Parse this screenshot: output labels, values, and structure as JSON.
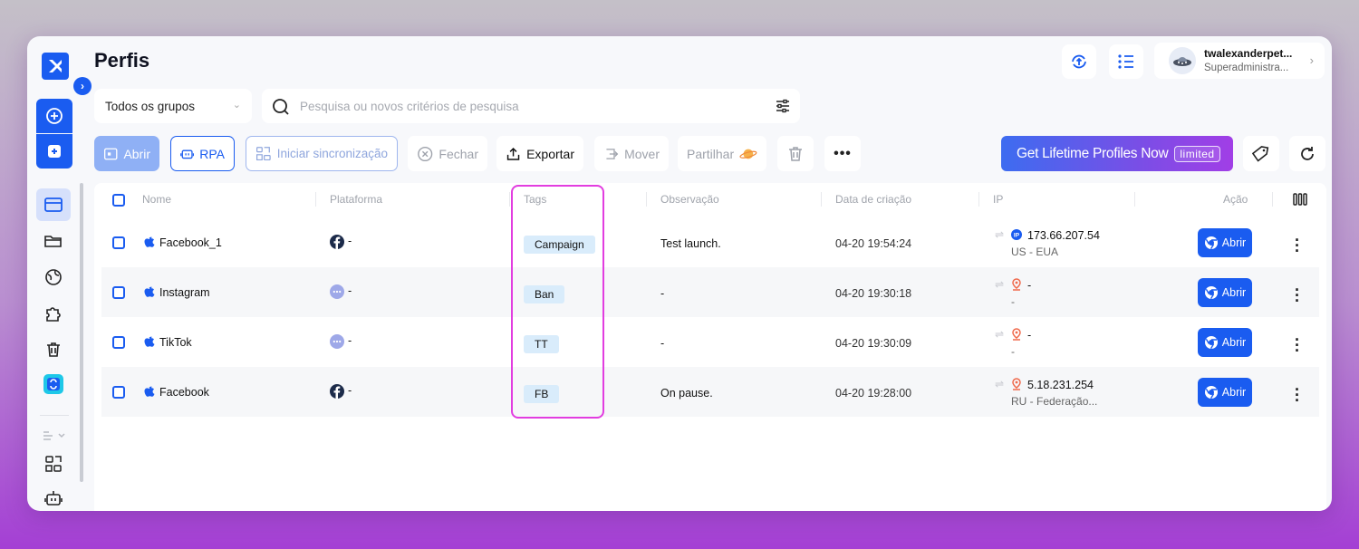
{
  "page": {
    "title": "Perfis"
  },
  "user": {
    "name": "twalexanderpet...",
    "role": "Superadministra..."
  },
  "filters": {
    "group_select": "Todos os grupos",
    "search_placeholder": "Pesquisa ou novos critérios de pesquisa"
  },
  "toolbar": {
    "open": "Abrir",
    "rpa": "RPA",
    "sync": "Iniciar sincronização",
    "close": "Fechar",
    "export": "Exportar",
    "move": "Mover",
    "share": "Partilhar",
    "more": "•••"
  },
  "promo": {
    "text": "Get Lifetime Profiles Now",
    "badge": "limited"
  },
  "table": {
    "headers": {
      "name": "Nome",
      "platform": "Plataforma",
      "tags": "Tags",
      "note": "Observação",
      "created": "Data de criação",
      "ip": "IP",
      "action": "Ação"
    },
    "rows": [
      {
        "name": "Facebook_1",
        "platform_icon": "facebook-icon",
        "platform": "-",
        "tag": "Campaign",
        "note": "Test launch.",
        "created": "04-20 19:54:24",
        "ip_icon": "ip-badge-icon",
        "ip": "173.66.207.54",
        "location": "US - EUA",
        "action": "Abrir"
      },
      {
        "name": "Instagram",
        "platform_icon": "more-dots-icon",
        "platform": "-",
        "tag": "Ban",
        "note": "-",
        "created": "04-20 19:30:18",
        "ip_icon": "location-pin-icon",
        "ip": "-",
        "location": "-",
        "action": "Abrir"
      },
      {
        "name": "TikTok",
        "platform_icon": "more-dots-icon",
        "platform": "-",
        "tag": "TT",
        "note": "-",
        "created": "04-20 19:30:09",
        "ip_icon": "location-pin-icon",
        "ip": "-",
        "location": "-",
        "action": "Abrir"
      },
      {
        "name": "Facebook",
        "platform_icon": "facebook-icon",
        "platform": "-",
        "tag": "FB",
        "note": "On pause.",
        "created": "04-20 19:28:00",
        "ip_icon": "location-pin-icon",
        "ip": "5.18.231.254",
        "location": "RU - Federação...",
        "action": "Abrir"
      }
    ]
  },
  "colors": {
    "accent": "#1a5cf0",
    "tag_bg": "#d9ecfb",
    "highlight": "#e23de0"
  }
}
